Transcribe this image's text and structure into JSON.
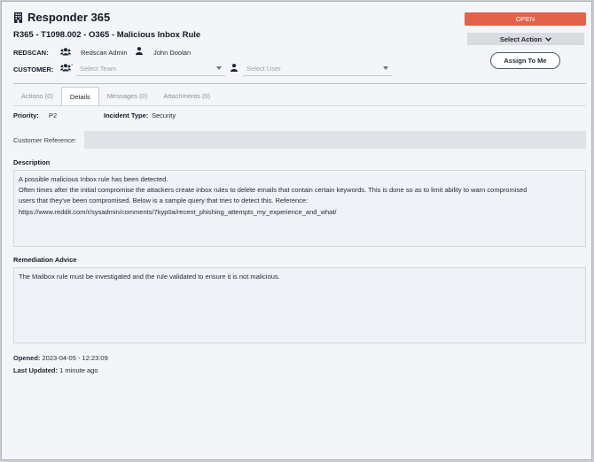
{
  "app": {
    "title": "Responder 365",
    "icon": "building-icon"
  },
  "case": {
    "title": "R365 - T1098.002 - O365 - Malicious Inbox Rule"
  },
  "redscan": {
    "label": "REDSCAN:",
    "team": "Redscan Admin",
    "user": "John Doolan"
  },
  "customer": {
    "label": "CUSTOMER:",
    "team_placeholder": "Select Team",
    "user_placeholder": "Select User"
  },
  "actions": {
    "status": "OPEN",
    "select_action": "Select Action",
    "assign": "Assign To Me",
    "status_color": "#e2624a"
  },
  "tabs": [
    {
      "label": "Actions (0)",
      "active": false
    },
    {
      "label": "Details",
      "active": true
    },
    {
      "label": "Messages (0)",
      "active": false
    },
    {
      "label": "Attachments (0)",
      "active": false
    }
  ],
  "details": {
    "priority_label": "Priority:",
    "priority": "P2",
    "incident_type_label": "Incident Type:",
    "incident_type": "Security",
    "customer_reference_label": "Customer Reference:",
    "customer_reference": "",
    "description_label": "Description",
    "description_lines": [
      "A possible malicious Inbox rule has been detected.",
      "Often times after the initial compromise the attackers create inbox rules to delete emails that contain certain keywords. This is done so as to limit ability to warn compromised",
      "users that they've been compromised. Below is a sample query that tries to detect this. Reference:",
      "https://www.reddit.com/r/sysadmin/comments/7kyp0a/recent_phishing_attempts_my_experience_and_what/"
    ],
    "remediation_label": "Remediation Advice",
    "remediation": "The Mailbox rule must be investigated and the rule validated to ensure it is not malicious.",
    "opened_label": "Opened:",
    "opened": "2023-04-05 - 12:23:09",
    "last_updated_label": "Last Updated:",
    "last_updated": "1 minute ago"
  }
}
